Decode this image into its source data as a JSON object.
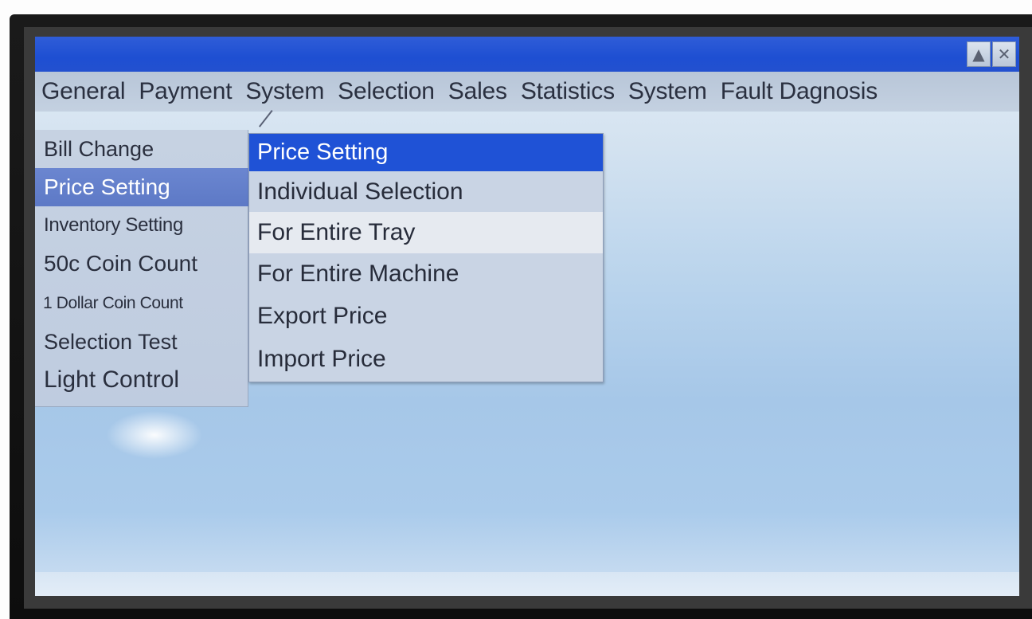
{
  "window": {
    "collapse_icon": "▲",
    "close_icon": "✕"
  },
  "menubar": {
    "items": [
      "General",
      "Payment",
      "System",
      "Selection",
      "Sales",
      "Statistics",
      "System",
      "Fault Dagnosis"
    ]
  },
  "submenu": {
    "items": [
      "Bill Change",
      "Price Setting",
      "Inventory Setting",
      "50c Coin Count",
      "1 Dollar Coin Count",
      "Selection Test",
      "Light Control"
    ],
    "selected": "Price Setting"
  },
  "popup": {
    "title": "Price Setting",
    "items": [
      "Individual Selection",
      "For Entire Tray",
      "For Entire Machine",
      "Export Price",
      "Import Price"
    ],
    "highlighted": "For Entire Tray"
  },
  "colors": {
    "titlebar": "#1e4fd2",
    "popup_header": "#1f52d6",
    "selected_item": "#6580cc",
    "menubar": "#bccadb"
  }
}
